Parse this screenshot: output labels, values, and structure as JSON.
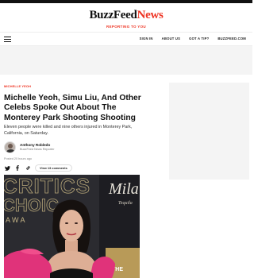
{
  "brand": {
    "logo_main": "BuzzFeed",
    "logo_news": "News",
    "tagline": "REPORTING TO YOU"
  },
  "nav": {
    "items": [
      "SIGN IN",
      "ABOUT US",
      "GOT A TIP?",
      "BUZZFEED.COM"
    ]
  },
  "article": {
    "category": "MICHELLE YEOH",
    "headline": "Michelle Yeoh, Simu Liu, And Other Celebs Spoke Out About The Monterey Park Shooting Shooting",
    "dek": "Eleven people were killed and nine others injured in Monterey Park, California, on Saturday.",
    "author_name": "Anthony Robledo",
    "author_role": "BuzzFeed News Reporter",
    "posted": "Posted 20 hours ago",
    "comments_label": "View 13 comments"
  },
  "hero_image": {
    "backdrop_text_1": "CRITICS",
    "backdrop_text_2": "CHOIC",
    "backdrop_text_3": "A W A",
    "backdrop_side": "Mila",
    "backdrop_side_2": "Tequila",
    "backdrop_badge": "THE"
  },
  "colors": {
    "brand_red": "#ee3322",
    "dress_pink": "#e0337a"
  },
  "icons": {
    "twitter": "twitter-icon",
    "facebook": "facebook-icon",
    "link": "link-icon"
  }
}
